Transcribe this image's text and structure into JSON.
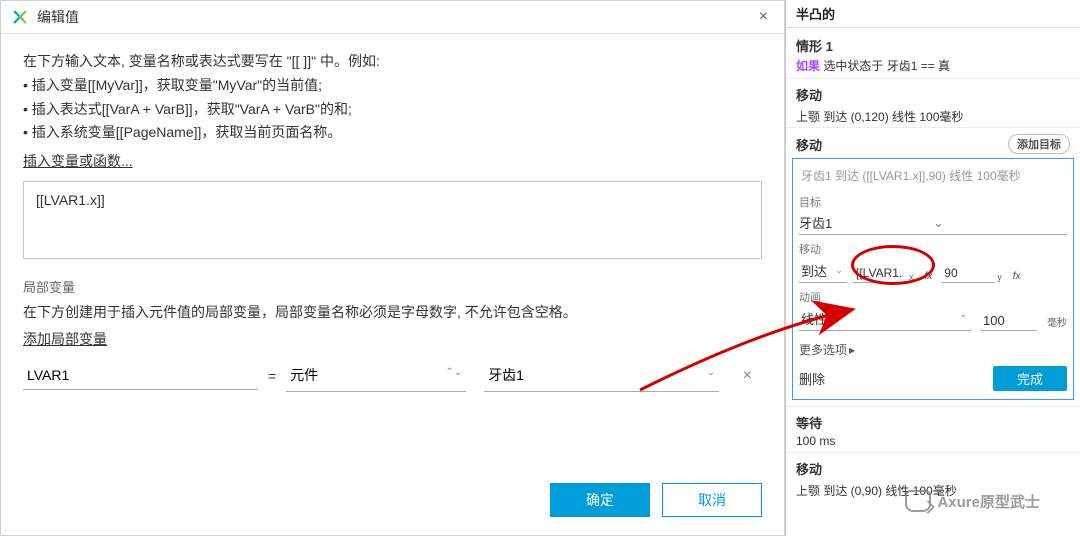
{
  "dialog": {
    "title": "编辑值",
    "intro_line1": "在下方输入文本, 变量名称或表达式要写在 \"[[ ]]\" 中。例如:",
    "intro_line2": "• 插入变量[[MyVar]]，获取变量\"MyVar\"的当前值;",
    "intro_line3": "• 插入表达式[[VarA + VarB]]，获取\"VarA + VarB\"的和;",
    "intro_line4": "• 插入系统变量[[PageName]]，获取当前页面名称。",
    "insert_link": "插入变量或函数...",
    "expression": "[[LVAR1.x]]",
    "local_var_label": "局部变量",
    "local_var_desc": "在下方创建用于插入元件值的局部变量，局部变量名称必须是字母数字, 不允许包含空格。",
    "add_local_var": "添加局部变量",
    "lv": {
      "name": "LVAR1",
      "type": "元件",
      "target": "牙齿1"
    },
    "ok": "确定",
    "cancel": "取消"
  },
  "side": {
    "top_cut": "半凸的",
    "case_title": "情形 1",
    "cond_kw": "如果",
    "cond_text": "选中状态于 牙齿1 == 真",
    "move_h": "移动",
    "move_line": "上颚 到达 (0,120) 线性 100毫秒",
    "add_target": "添加目标",
    "edit_header": "牙齿1 到达 ([[LVAR1.x]],90) 线性 100毫秒",
    "target_lbl": "目标",
    "target_val": "牙齿1",
    "move_lbl": "移动",
    "arrive": "到达",
    "x_val": "[[LVAR1.",
    "x_sub": "x",
    "y_val": "90",
    "y_sub": "y",
    "fx": "fx",
    "anim_lbl": "动画",
    "anim_type": "线性",
    "anim_val": "100",
    "anim_unit": "毫秒",
    "more": "更多选项",
    "delete": "删除",
    "done": "完成",
    "wait_h": "等待",
    "wait_val": "100 ms",
    "move2_h": "移动",
    "move2_line": "上颚 到达 (0,90) 线性 100毫秒"
  },
  "watermark": "Axure原型武士"
}
